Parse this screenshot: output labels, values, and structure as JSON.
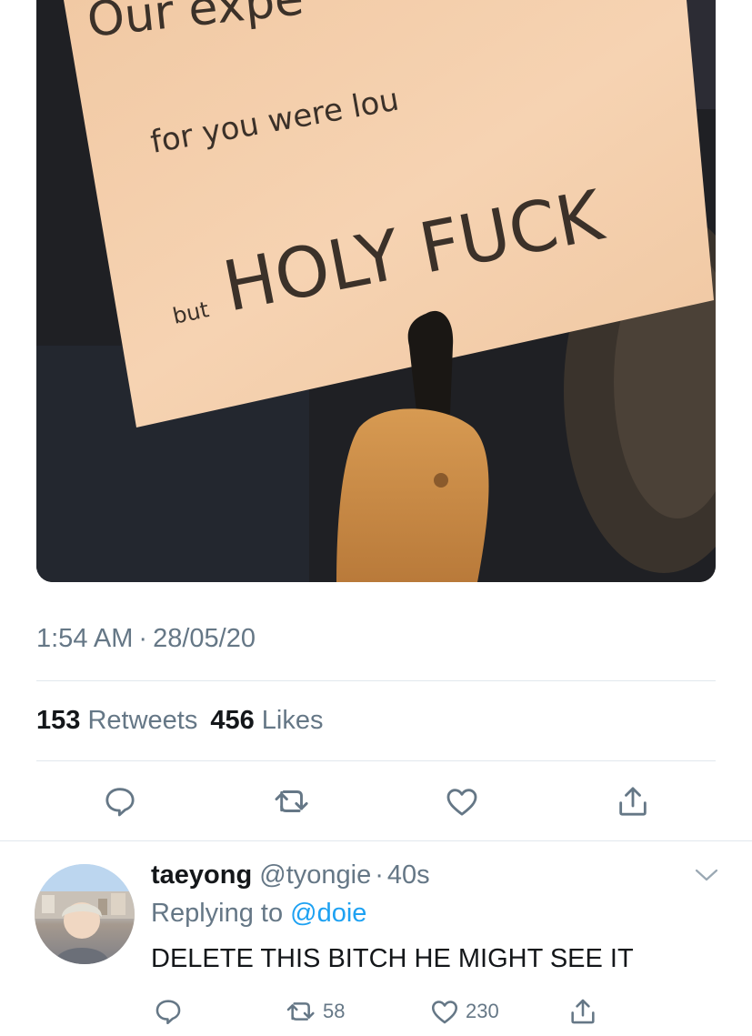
{
  "photo": {
    "sign_line1": "Our expe",
    "sign_line2": "for you were lou",
    "sign_line3_small": "but",
    "sign_line3": "HOLY FUCK"
  },
  "tweet": {
    "time": "1:54 AM",
    "date": "28/05/20",
    "retweet_count": "153",
    "retweet_label": "Retweets",
    "like_count": "456",
    "like_label": "Likes"
  },
  "actions": {
    "icons": [
      "reply-icon",
      "retweet-icon",
      "like-icon",
      "share-icon"
    ]
  },
  "reply": {
    "name": "taeyong",
    "handle": "@tyongie",
    "time": "40s",
    "replying_label": "Replying to",
    "replying_mention": "@doie",
    "text": "DELETE THIS BITCH HE MIGHT SEE IT",
    "retweets": "58",
    "likes": "230"
  },
  "colors": {
    "text": "#14171a",
    "secondary": "#657786",
    "link": "#1da1f2",
    "divider": "#e1e8ed"
  }
}
